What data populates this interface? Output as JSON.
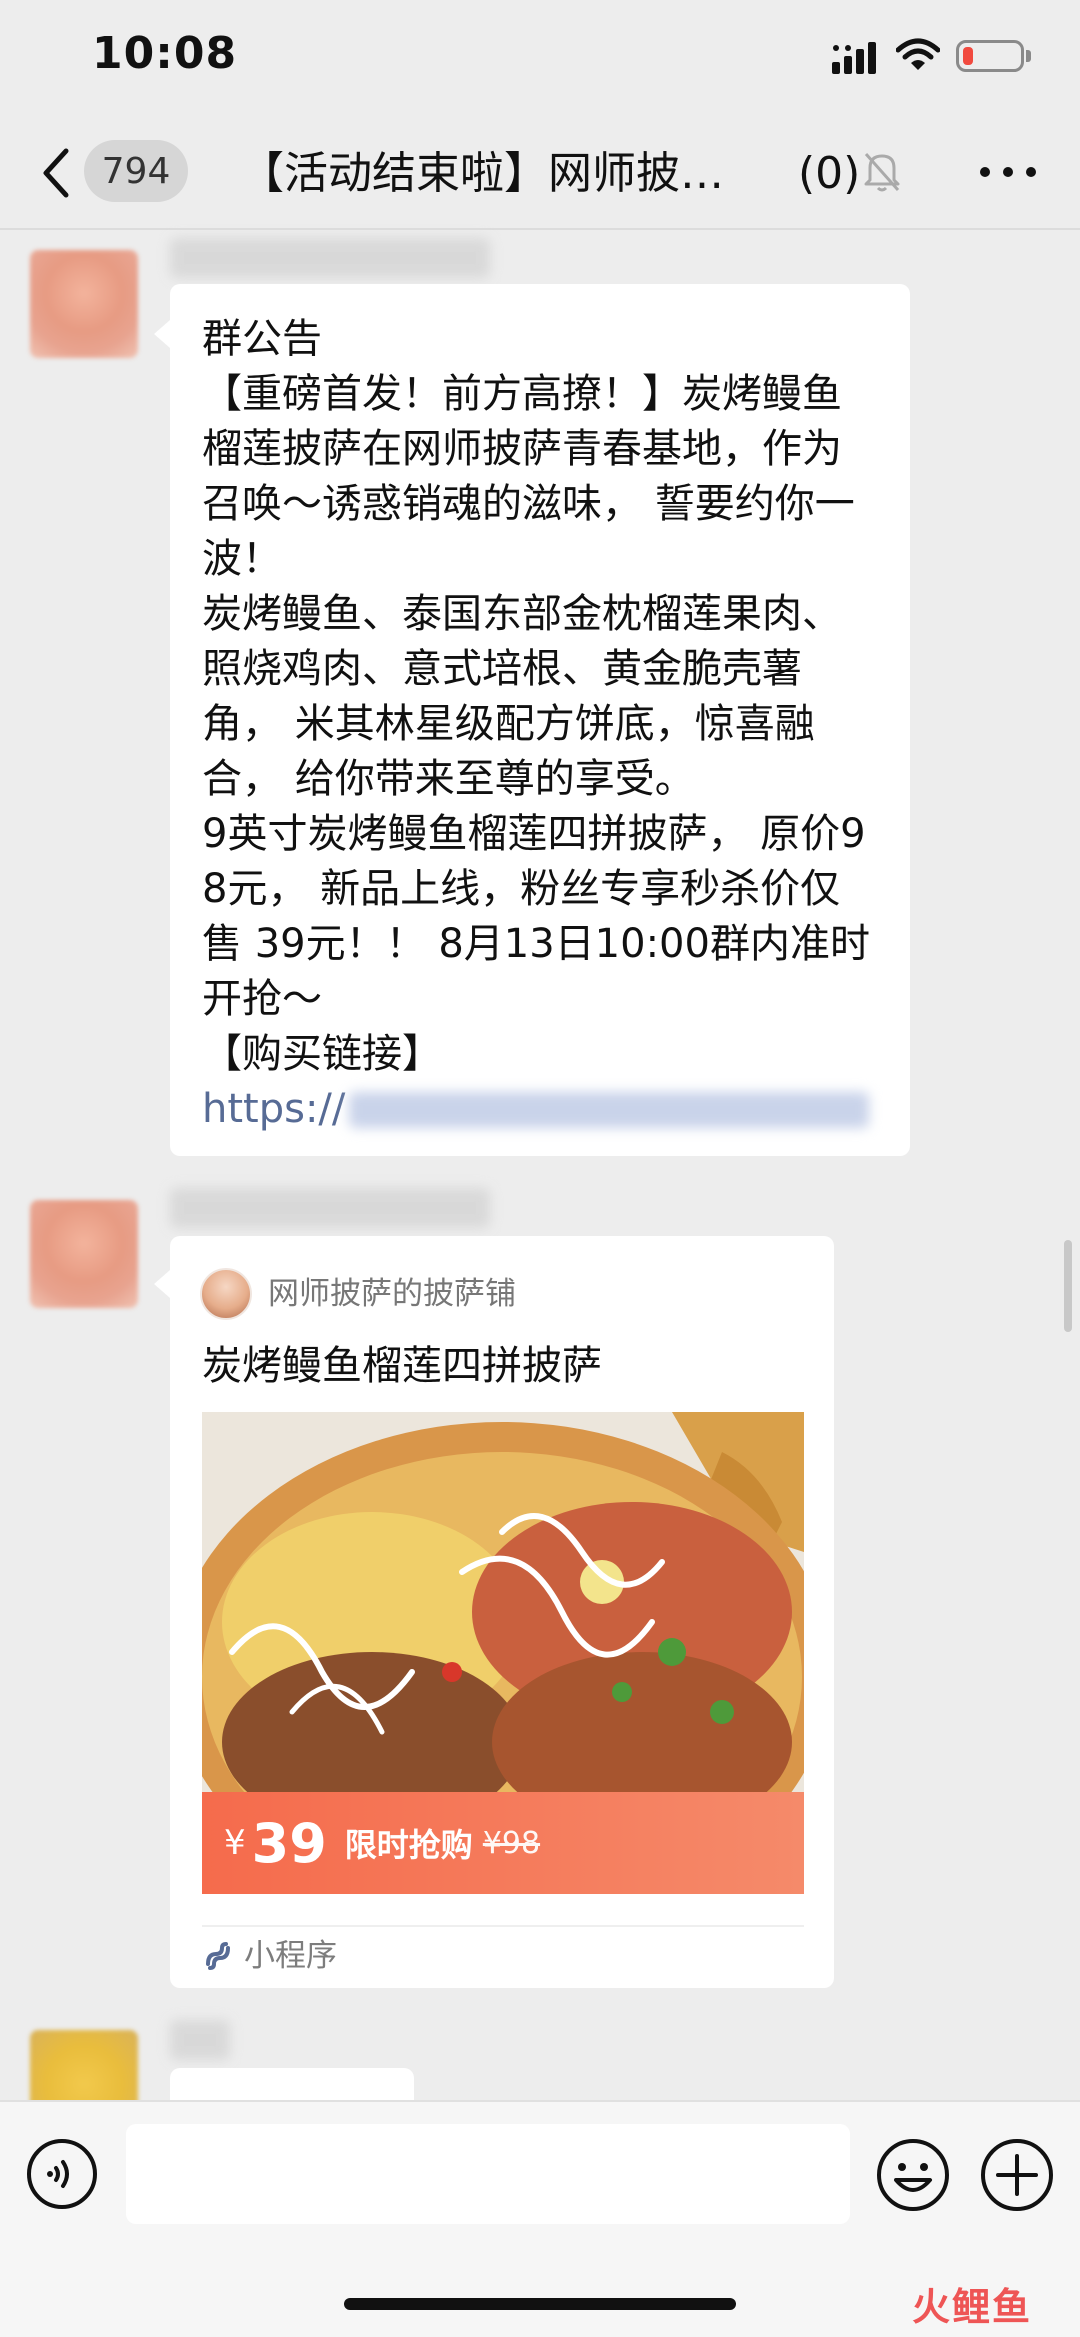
{
  "status_bar": {
    "time": "10:08"
  },
  "nav": {
    "unread_count": "794",
    "title": "【活动结束啦】网师披萨...",
    "member_count": "(0)"
  },
  "messages": {
    "announcement": {
      "title": "群公告",
      "body": "【重磅首发！前方高撩！】炭烤鳗鱼榴莲披萨在网师披萨青春基地，作为召唤～诱惑销魂的滋味， 誓要约你一波！\n炭烤鳗鱼、泰国东部金枕榴莲果肉、照烧鸡肉、意式培根、黄金脆壳薯角， 米其林星级配方饼底，惊喜融合， 给你带来至尊的享受。\n9英寸炭烤鳗鱼榴莲四拼披萨， 原价98元， 新品上线，粉丝专享秒杀价仅售 39元！！ 8月13日10:00群内准时开抢～\n【购买链接】",
      "link_prefix": "https://"
    },
    "mini_program": {
      "app_name": "网师披萨的披萨铺",
      "title": "炭烤鳗鱼榴莲四拼披萨",
      "price_currency": "¥",
      "price_now": "39",
      "price_tag": "限时抢购",
      "price_old": "¥98",
      "footer_label": "小程序"
    }
  },
  "input": {
    "value": "",
    "placeholder": ""
  },
  "watermark": "火鲤鱼",
  "colors": {
    "link": "#576b95",
    "price_bar": "#f56b4c",
    "battery_low": "#f14a3f"
  },
  "icons": [
    "back-icon",
    "mute-bell-icon",
    "more-icon",
    "voice-icon",
    "emoji-icon",
    "plus-icon",
    "mini-program-icon",
    "signal-icon",
    "wifi-icon",
    "battery-icon"
  ]
}
